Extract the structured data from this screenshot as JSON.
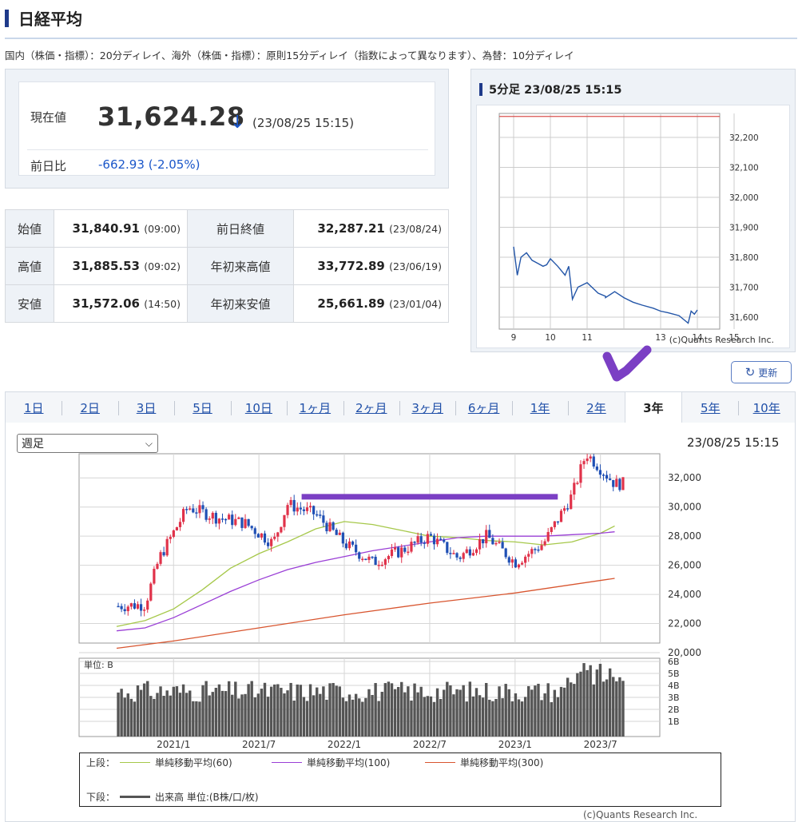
{
  "header": {
    "title": "日経平均"
  },
  "notice": "国内（株価・指標）：20分ディレイ、海外（株価・指標）：原則15分ディレイ（指数によって異なります）、為替：10分ディレイ",
  "price": {
    "current_label": "現在値",
    "current_value": "31,624.28",
    "arrow": "↓",
    "timestamp": "(23/08/25 15:15)",
    "change_label": "前日比",
    "change_value": "-662.93",
    "change_pct": "(-2.05%)"
  },
  "stats": [
    {
      "label": "始値",
      "value": "31,840.91",
      "note": "(09:00)",
      "label2": "前日終値",
      "value2": "32,287.21",
      "note2": "(23/08/24)"
    },
    {
      "label": "高値",
      "value": "31,885.53",
      "note": "(09:02)",
      "label2": "年初来高値",
      "value2": "33,772.89",
      "note2": "(23/06/19)"
    },
    {
      "label": "安値",
      "value": "31,572.06",
      "note": "(14:50)",
      "label2": "年初来安値",
      "value2": "25,661.89",
      "note2": "(23/01/04)"
    }
  ],
  "intraday": {
    "title": "5分足 23/08/25 15:15",
    "copyright": "(c)Quants Research Inc.",
    "y_ticks": [
      "32,200",
      "32,100",
      "32,000",
      "31,900",
      "31,800",
      "31,700",
      "31,600"
    ],
    "x_ticks": [
      "9",
      "10",
      "11",
      "13",
      "14",
      "15"
    ]
  },
  "refresh": {
    "label": "更新"
  },
  "tabs": [
    {
      "label": "1日",
      "active": false
    },
    {
      "label": "2日",
      "active": false
    },
    {
      "label": "3日",
      "active": false
    },
    {
      "label": "5日",
      "active": false
    },
    {
      "label": "10日",
      "active": false
    },
    {
      "label": "1ヶ月",
      "active": false
    },
    {
      "label": "2ヶ月",
      "active": false
    },
    {
      "label": "3ヶ月",
      "active": false
    },
    {
      "label": "6ヶ月",
      "active": false
    },
    {
      "label": "1年",
      "active": false
    },
    {
      "label": "2年",
      "active": false
    },
    {
      "label": "3年",
      "active": true
    },
    {
      "label": "5年",
      "active": false
    },
    {
      "label": "10年",
      "active": false
    }
  ],
  "main_chart": {
    "period_select": "週足",
    "timestamp": "23/08/25 15:15",
    "y_ticks": [
      "32,000",
      "30,000",
      "28,000",
      "26,000",
      "24,000",
      "22,000",
      "20,000"
    ],
    "volume_unit": "単位: B",
    "volume_ticks": [
      "6B",
      "5B",
      "4B",
      "3B",
      "2B",
      "1B"
    ],
    "x_ticks": [
      "2021/1",
      "2021/7",
      "2022/1",
      "2022/7",
      "2023/1",
      "2023/7"
    ],
    "copyright": "(c)Quants Research Inc."
  },
  "legend": {
    "upper_label": "上段：",
    "ma60": "単純移動平均(60)",
    "ma100": "単純移動平均(100)",
    "ma300": "単純移動平均(300)",
    "lower_label": "下段：",
    "volume": "出来高 単位:(B株/口/枚)"
  },
  "colors": {
    "up": "#e0324a",
    "down": "#1f4fb4",
    "ma60": "#a6c84a",
    "ma100": "#9a3fd6",
    "ma300": "#d8552f",
    "annotation": "#7b3fc4",
    "volume": "#555555"
  },
  "chart_data": [
    {
      "type": "line",
      "title": "5分足 23/08/25 15:15",
      "x_range": [
        9,
        15
      ],
      "ylim": [
        31560,
        32280
      ],
      "reference_line": 32287.21,
      "series": [
        {
          "x": [
            9.0,
            9.1,
            9.2,
            9.35,
            9.5,
            9.65,
            9.8,
            9.9,
            10.0,
            10.2,
            10.4,
            10.5,
            10.6,
            10.75,
            11.0,
            11.3,
            11.5,
            12.5,
            12.75,
            13.0,
            13.25,
            13.5,
            13.8,
            14.0,
            14.2,
            14.5,
            14.75,
            14.83,
            14.92,
            15.0
          ],
          "y": [
            31835,
            31740,
            31800,
            31815,
            31790,
            31780,
            31770,
            31775,
            31795,
            31770,
            31740,
            31770,
            31660,
            31700,
            31715,
            31680,
            31670,
            31665,
            31685,
            31665,
            31650,
            31640,
            31630,
            31620,
            31615,
            31605,
            31580,
            31620,
            31610,
            31624
          ]
        }
      ]
    },
    {
      "type": "candlestick",
      "title": "",
      "x_range": [
        "2020/9",
        "2023/8"
      ],
      "ylim": [
        20000,
        34000
      ],
      "series": [
        {
          "name": "単純移動平均(60)",
          "x": [
            "2020/9",
            "2020/11",
            "2021/1",
            "2021/3",
            "2021/5",
            "2021/7",
            "2021/9",
            "2021/11",
            "2022/1",
            "2022/3",
            "2022/5",
            "2022/7",
            "2022/9",
            "2022/11",
            "2023/1",
            "2023/3",
            "2023/5",
            "2023/7",
            "2023/8"
          ],
          "values": [
            21800,
            22200,
            23000,
            24300,
            25800,
            26800,
            27600,
            28500,
            29000,
            28800,
            28400,
            28000,
            27900,
            27700,
            27600,
            27400,
            27600,
            28200,
            28700
          ]
        },
        {
          "name": "単純移動平均(100)",
          "x": [
            "2020/9",
            "2020/11",
            "2021/1",
            "2021/3",
            "2021/5",
            "2021/7",
            "2021/9",
            "2021/11",
            "2022/1",
            "2022/3",
            "2022/5",
            "2022/7",
            "2022/9",
            "2022/11",
            "2023/1",
            "2023/3",
            "2023/5",
            "2023/7",
            "2023/8"
          ],
          "values": [
            21500,
            21700,
            22400,
            23300,
            24200,
            25000,
            25700,
            26200,
            26600,
            27000,
            27300,
            27600,
            27900,
            28000,
            28000,
            28000,
            28100,
            28200,
            28300
          ]
        },
        {
          "name": "単純移動平均(300)",
          "x": [
            "2020/9",
            "2021/1",
            "2021/7",
            "2022/1",
            "2022/7",
            "2023/1",
            "2023/8"
          ],
          "values": [
            20300,
            20800,
            21700,
            22600,
            23400,
            24100,
            25100
          ]
        },
        {
          "name": "週足",
          "x": [
            "2020/9",
            "2020/11",
            "2020/12",
            "2021/2",
            "2021/4",
            "2021/6",
            "2021/8",
            "2021/9",
            "2021/11",
            "2022/1",
            "2022/3",
            "2022/5",
            "2022/7",
            "2022/9",
            "2022/11",
            "2023/1",
            "2023/3",
            "2023/5",
            "2023/6",
            "2023/8"
          ],
          "values": [
            23200,
            23300,
            26500,
            30000,
            29300,
            28900,
            27500,
            30200,
            29500,
            27500,
            26200,
            27000,
            28000,
            26500,
            28000,
            26200,
            27500,
            30800,
            33700,
            31600
          ]
        }
      ],
      "annotation_line": {
        "x": [
          "2021/10",
          "2023/4"
        ],
        "value": 30700
      },
      "volume": {
        "ylim": [
          0,
          6
        ],
        "unit": "B"
      }
    }
  ]
}
